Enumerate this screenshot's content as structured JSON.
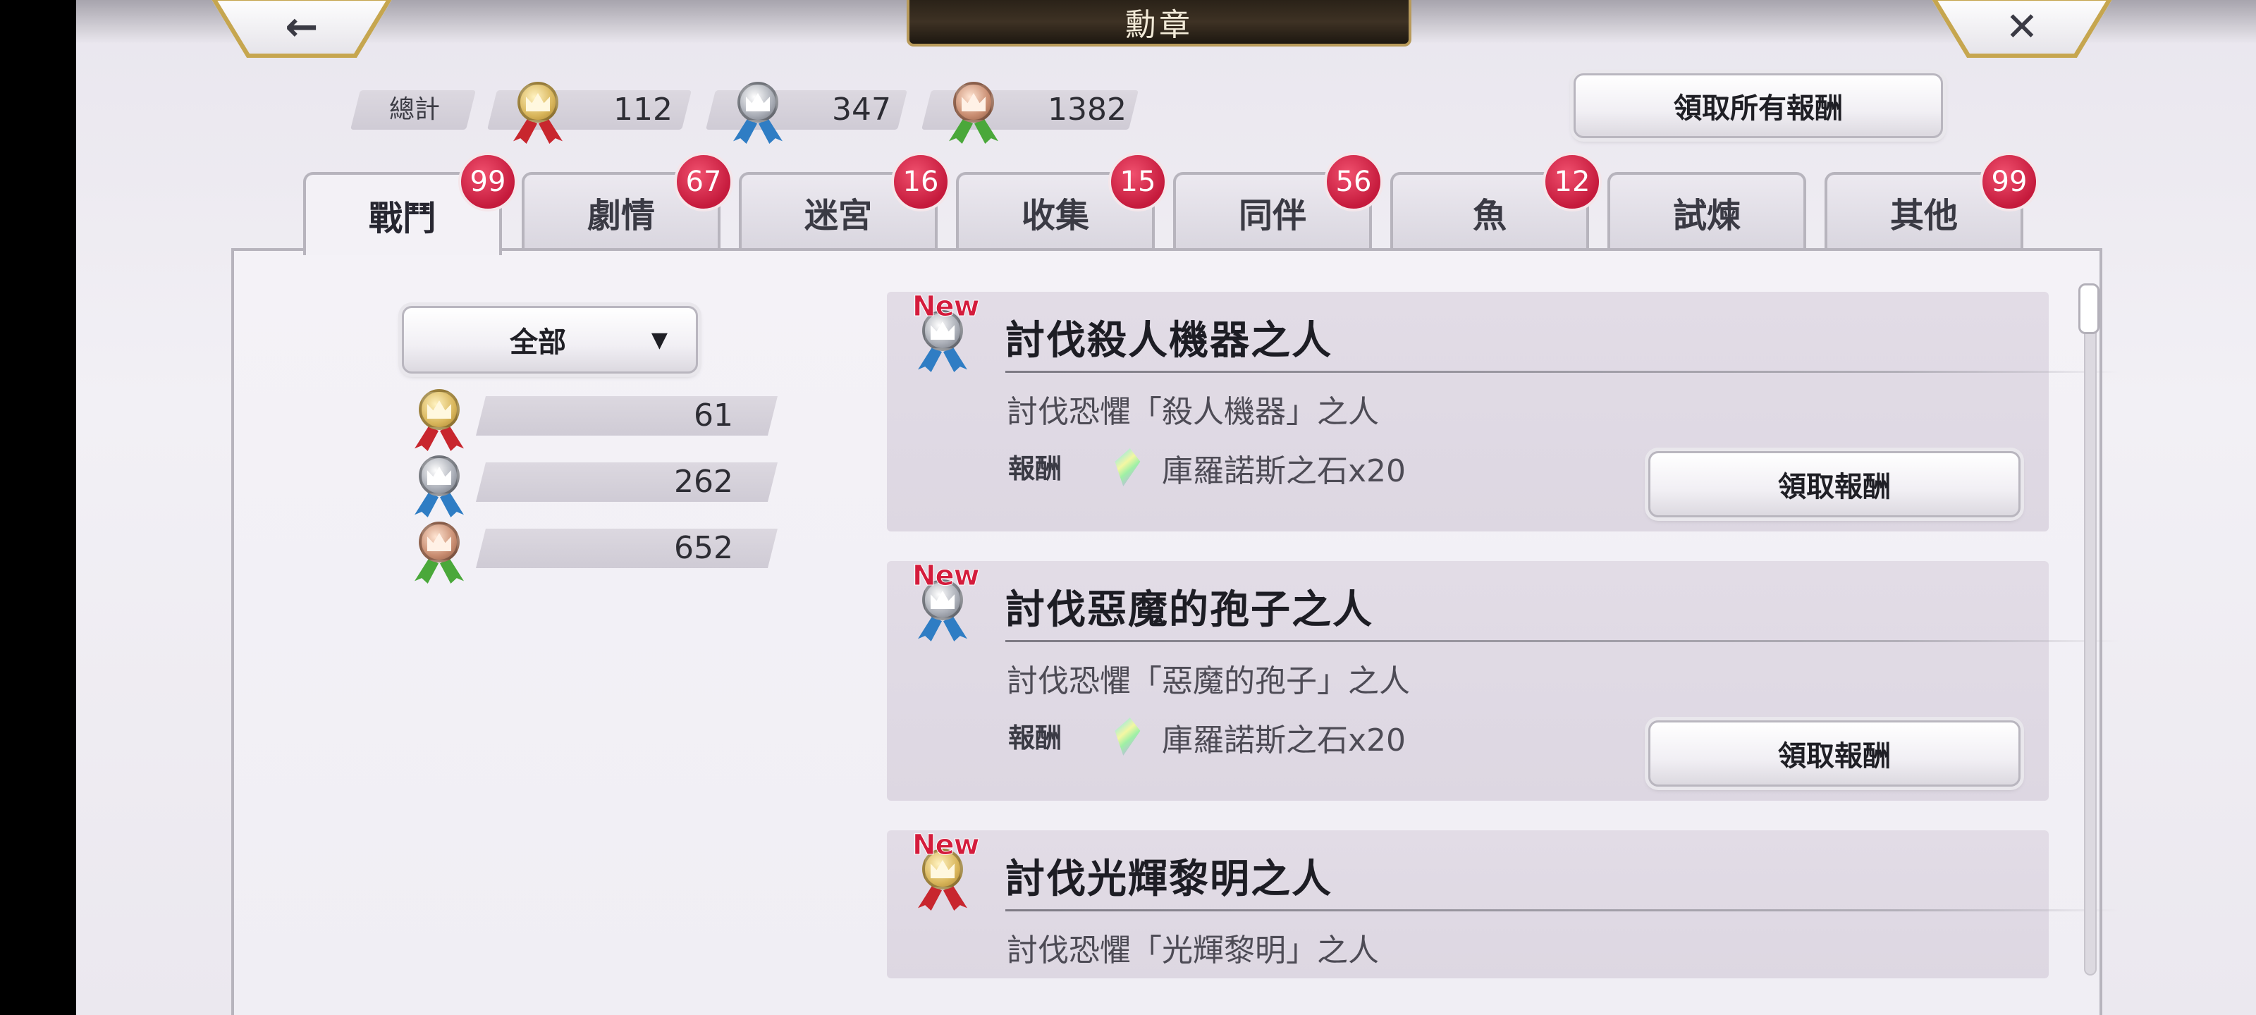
{
  "header": {
    "title": "勳章",
    "back_icon": "←",
    "close_icon": "✕"
  },
  "totals": {
    "label": "總計",
    "gold": "112",
    "silver": "347",
    "bronze": "1382"
  },
  "claim_all_label": "領取所有報酬",
  "tabs": [
    {
      "label": "戰鬥",
      "badge": "99"
    },
    {
      "label": "劇情",
      "badge": "67"
    },
    {
      "label": "迷宮",
      "badge": "16"
    },
    {
      "label": "收集",
      "badge": "15"
    },
    {
      "label": "同伴",
      "badge": "56"
    },
    {
      "label": "魚",
      "badge": "12"
    },
    {
      "label": "試煉",
      "badge": ""
    },
    {
      "label": "其他",
      "badge": "99"
    }
  ],
  "filter": {
    "selected": "全部",
    "arrow": "▼"
  },
  "counts": {
    "gold": "61",
    "silver": "262",
    "bronze": "652"
  },
  "cards": [
    {
      "new": "New",
      "title": "討伐殺人機器之人",
      "desc": "討伐恐懼「殺人機器」之人",
      "reward_label": "報酬",
      "reward": "庫羅諾斯之石x20",
      "button": "領取報酬",
      "medal": "silver"
    },
    {
      "new": "New",
      "title": "討伐惡魔的孢子之人",
      "desc": "討伐恐懼「惡魔的孢子」之人",
      "reward_label": "報酬",
      "reward": "庫羅諾斯之石x20",
      "button": "領取報酬",
      "medal": "silver"
    },
    {
      "new": "New",
      "title": "討伐光輝黎明之人",
      "desc": "討伐恐懼「光輝黎明」之人",
      "medal": "gold"
    }
  ],
  "colors": {
    "badge": "#c51a3c",
    "new_tag": "#d41c3c",
    "title_plate": "#2a2218",
    "gold_trim": "#c6a64f",
    "ribbon_red": "#c8262e",
    "ribbon_blue": "#2f7dc4",
    "ribbon_green": "#4aa83a"
  }
}
